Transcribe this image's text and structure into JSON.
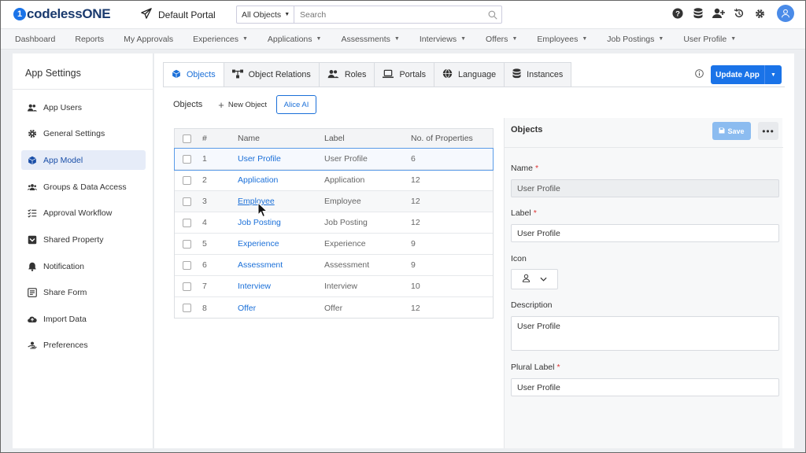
{
  "brand": {
    "logo_mark": "1",
    "logo_text": "codelessONE"
  },
  "portal": {
    "name": "Default Portal"
  },
  "search": {
    "scope": "All Objects",
    "placeholder": "Search"
  },
  "nav": {
    "items": [
      "Dashboard",
      "Reports",
      "My Approvals",
      "Experiences",
      "Applications",
      "Assessments",
      "Interviews",
      "Offers",
      "Employees",
      "Job Postings",
      "User Profile"
    ],
    "has_caret": [
      false,
      false,
      false,
      true,
      true,
      true,
      true,
      true,
      true,
      true,
      true
    ]
  },
  "sidebar": {
    "title": "App Settings",
    "items": [
      {
        "label": "App Users",
        "icon": "users-icon"
      },
      {
        "label": "General Settings",
        "icon": "gear-icon"
      },
      {
        "label": "App Model",
        "icon": "cube-icon",
        "active": true
      },
      {
        "label": "Groups & Data Access",
        "icon": "group-icon"
      },
      {
        "label": "Approval Workflow",
        "icon": "list-check-icon"
      },
      {
        "label": "Shared Property",
        "icon": "inbox-icon"
      },
      {
        "label": "Notification",
        "icon": "bell-icon"
      },
      {
        "label": "Share Form",
        "icon": "form-icon"
      },
      {
        "label": "Import Data",
        "icon": "cloud-upload-icon"
      },
      {
        "label": "Preferences",
        "icon": "hand-user-icon"
      }
    ]
  },
  "tabs": [
    {
      "label": "Objects",
      "active": true
    },
    {
      "label": "Object Relations"
    },
    {
      "label": "Roles"
    },
    {
      "label": "Portals"
    },
    {
      "label": "Language"
    },
    {
      "label": "Instances"
    }
  ],
  "update_button": {
    "label": "Update App"
  },
  "subbar": {
    "title": "Objects",
    "new_object": "New Object",
    "alice": "Alice AI"
  },
  "table": {
    "headers": {
      "num": "#",
      "name": "Name",
      "label": "Label",
      "props": "No. of Properties"
    },
    "rows": [
      {
        "num": "1",
        "name": "User Profile",
        "label": "User Profile",
        "props": "6"
      },
      {
        "num": "2",
        "name": "Application",
        "label": "Application",
        "props": "12"
      },
      {
        "num": "3",
        "name": "Employee",
        "label": "Employee",
        "props": "12"
      },
      {
        "num": "4",
        "name": "Job Posting",
        "label": "Job Posting",
        "props": "12"
      },
      {
        "num": "5",
        "name": "Experience",
        "label": "Experience",
        "props": "9"
      },
      {
        "num": "6",
        "name": "Assessment",
        "label": "Assessment",
        "props": "9"
      },
      {
        "num": "7",
        "name": "Interview",
        "label": "Interview",
        "props": "10"
      },
      {
        "num": "8",
        "name": "Offer",
        "label": "Offer",
        "props": "12"
      }
    ]
  },
  "detail": {
    "title": "Objects",
    "save": "Save",
    "more": "•••",
    "name_label": "Name",
    "name_value": "User Profile",
    "label_label": "Label",
    "label_value": "User Profile",
    "icon_label": "Icon",
    "description_label": "Description",
    "description_value": "User Profile",
    "plural_label": "Plural Label",
    "plural_value": "User Profile",
    "required_mark": "*"
  },
  "colors": {
    "accent": "#1a73e8",
    "link": "#1a6fd8",
    "required": "#d33333"
  }
}
